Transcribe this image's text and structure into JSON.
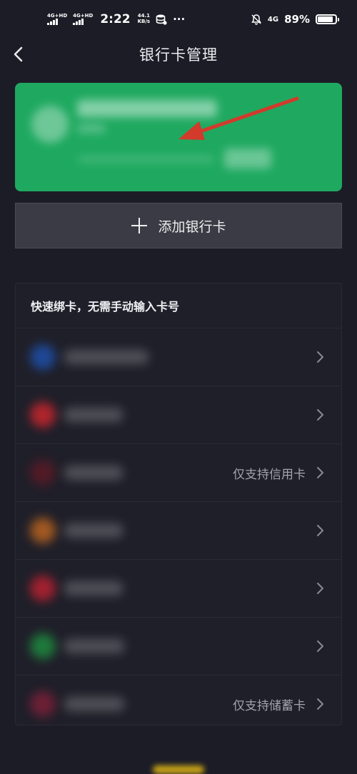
{
  "status_bar": {
    "signal1_label": "4G+HD",
    "signal2_label": "4G+HD",
    "time": "2:22",
    "speed_value": "44.1",
    "speed_unit": "KB/s",
    "more": "···",
    "network": "4G",
    "battery": "89%",
    "battery_level": 0.89
  },
  "header": {
    "title": "银行卡管理",
    "back_icon": "chevron-left-icon"
  },
  "add_card": {
    "label": "添加银行卡",
    "icon": "plus-icon"
  },
  "quick_bind": {
    "title": "快速绑卡，无需手动输入卡号",
    "rows": [
      {
        "note": "",
        "logo_color": "#1f4fa8"
      },
      {
        "note": "",
        "logo_color": "#c8262d"
      },
      {
        "note": "仅支持信用卡",
        "logo_color": "#5a1a26"
      },
      {
        "note": "",
        "logo_color": "#b86320"
      },
      {
        "note": "",
        "logo_color": "#b82130"
      },
      {
        "note": "",
        "logo_color": "#1f8a3f"
      },
      {
        "note": "仅支持储蓄卡",
        "logo_color": "#7a2038"
      }
    ]
  },
  "colors": {
    "background": "#1c1c26",
    "card_green": "#1fa960",
    "arrow_red": "#d23a2b",
    "add_button": "#3b3b45"
  }
}
